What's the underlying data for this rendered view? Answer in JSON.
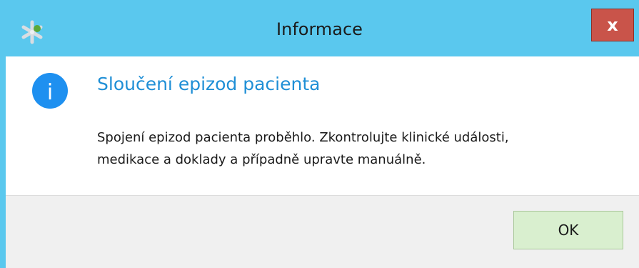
{
  "window": {
    "title": "Informace",
    "app_icon": "asterisk-icon",
    "close_label": "x"
  },
  "content": {
    "icon": "info-icon",
    "icon_glyph": "i",
    "heading": "Sloučení epizod pacienta",
    "message_line1": "Spojení epizod pacienta proběhlo. Zkontrolujte klinické události,",
    "message_line2": "medikace a doklady a případně upravte manuálně."
  },
  "footer": {
    "ok_label": "OK"
  },
  "colors": {
    "titlebar": "#5ac8ee",
    "close_button": "#c9544a",
    "heading": "#1f8fd6",
    "info_icon": "#1e90f0",
    "ok_button": "#d9efcf",
    "footer": "#f0f0f0"
  }
}
